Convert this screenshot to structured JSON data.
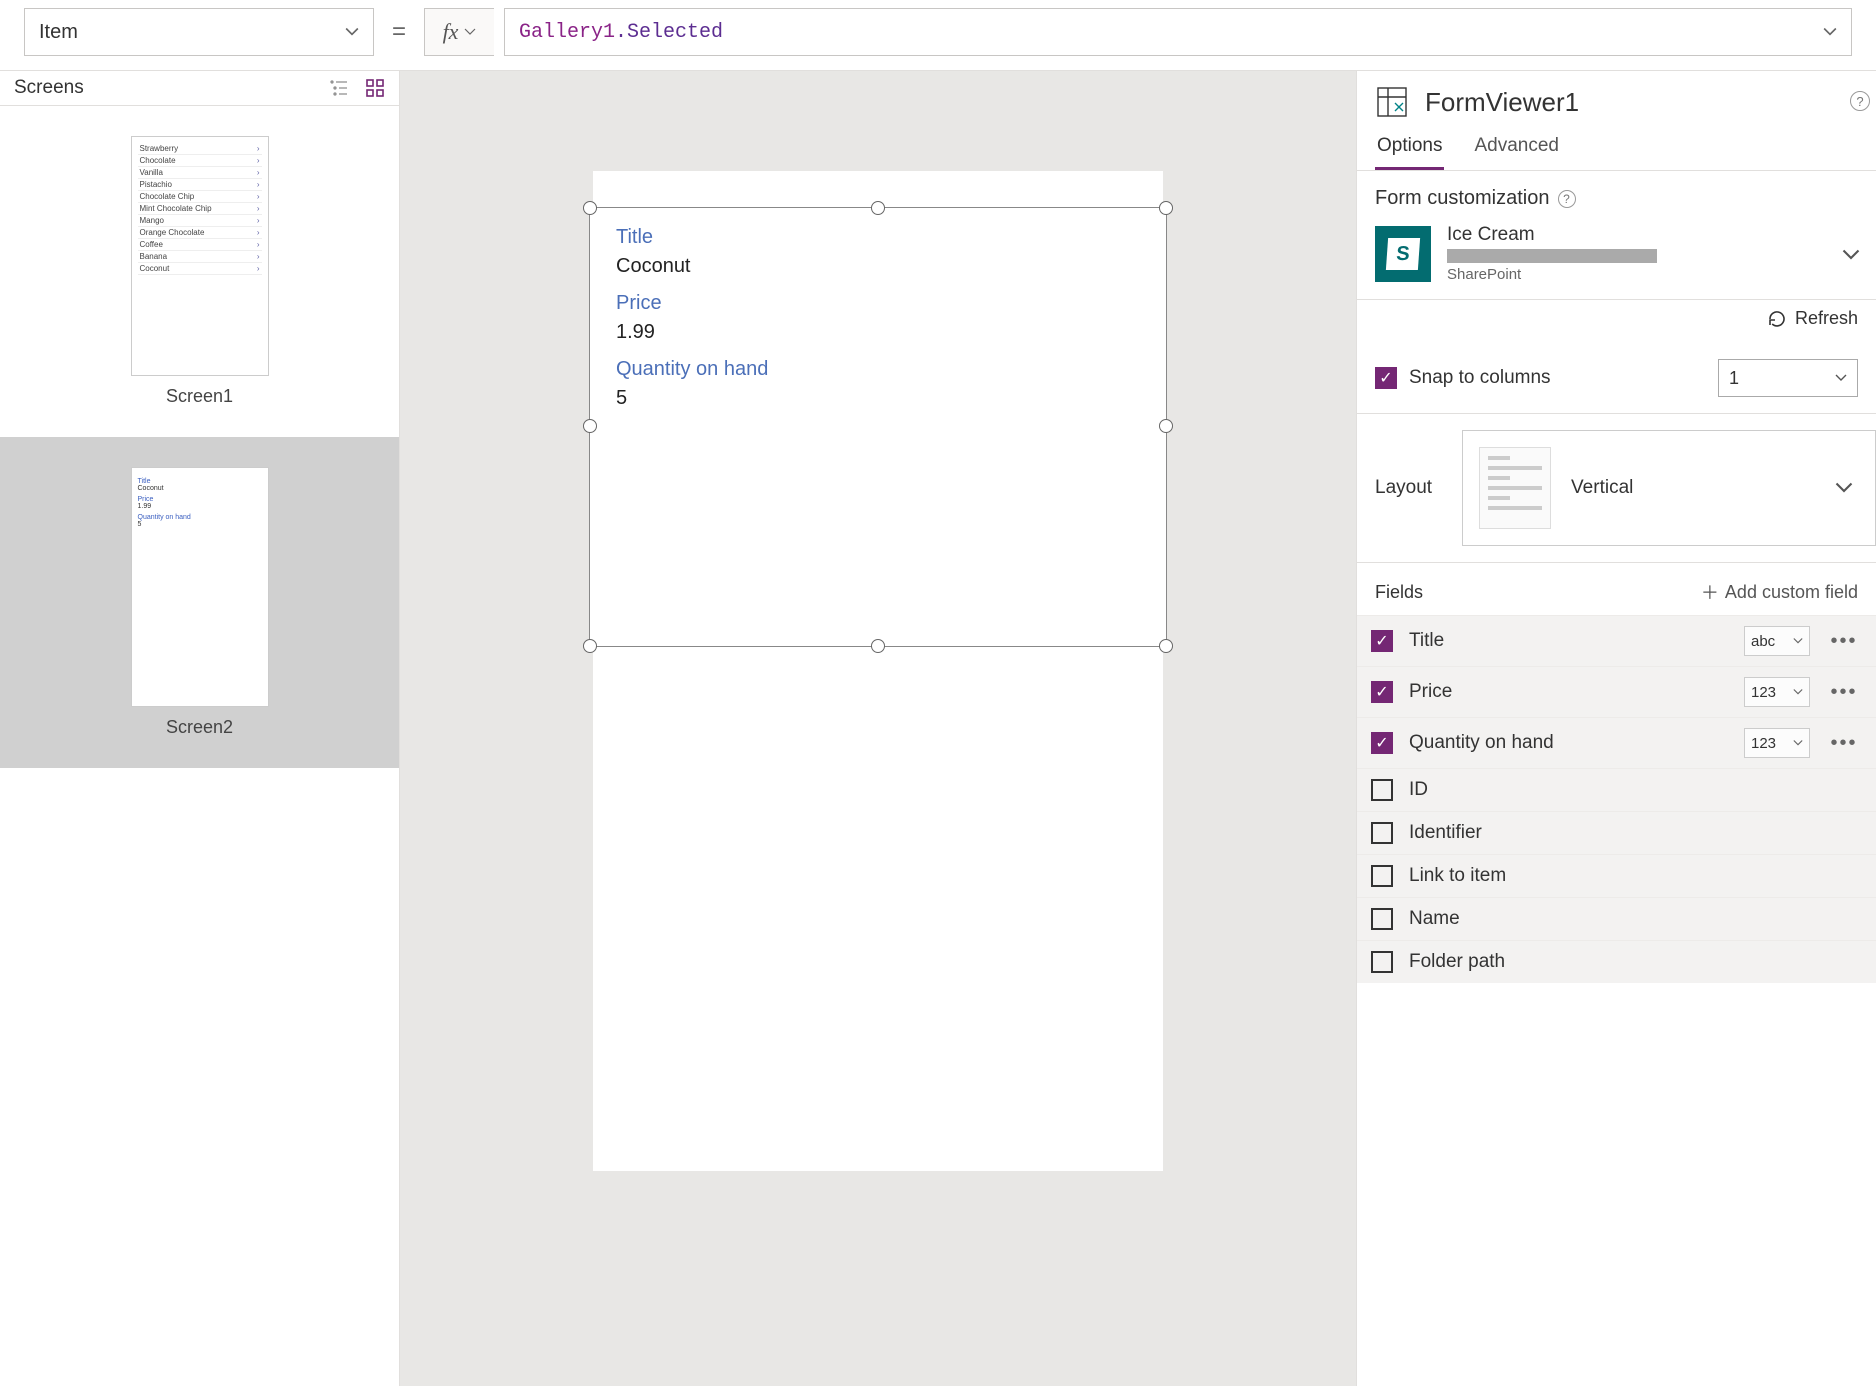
{
  "formula_bar": {
    "property": "Item",
    "equals": "=",
    "fx": "fx",
    "formula_ident": "Gallery1",
    "formula_prop": ".Selected"
  },
  "screens": {
    "header": "Screens",
    "screen1": {
      "caption": "Screen1",
      "rows": [
        "Strawberry",
        "Chocolate",
        "Vanilla",
        "Pistachio",
        "Chocolate Chip",
        "Mint Chocolate Chip",
        "Mango",
        "Orange Chocolate",
        "Coffee",
        "Banana",
        "Coconut"
      ]
    },
    "screen2": {
      "caption": "Screen2",
      "fields": [
        {
          "lbl": "Title",
          "val": "Coconut"
        },
        {
          "lbl": "Price",
          "val": "1.99"
        },
        {
          "lbl": "Quantity on hand",
          "val": "5"
        }
      ]
    }
  },
  "canvas": {
    "form": [
      {
        "lbl": "Title",
        "val": "Coconut"
      },
      {
        "lbl": "Price",
        "val": "1.99"
      },
      {
        "lbl": "Quantity on hand",
        "val": "5"
      }
    ]
  },
  "props": {
    "control_name": "FormViewer1",
    "help_glyph": "?",
    "tabs": {
      "options": "Options",
      "advanced": "Advanced"
    },
    "form_customization": "Form customization",
    "datasource": {
      "name": "Ice Cream",
      "source": "SharePoint"
    },
    "refresh": "Refresh",
    "snap": {
      "label": "Snap to columns",
      "columns": "1"
    },
    "layout": {
      "label": "Layout",
      "value": "Vertical"
    },
    "fields_header": "Fields",
    "add_field": "Add custom field",
    "fields": [
      {
        "label": "Title",
        "type": "abc",
        "checked": true
      },
      {
        "label": "Price",
        "type": "123",
        "checked": true
      },
      {
        "label": "Quantity on hand",
        "type": "123",
        "checked": true
      },
      {
        "label": "ID",
        "type": "",
        "checked": false
      },
      {
        "label": "Identifier",
        "type": "",
        "checked": false
      },
      {
        "label": "Link to item",
        "type": "",
        "checked": false
      },
      {
        "label": "Name",
        "type": "",
        "checked": false
      },
      {
        "label": "Folder path",
        "type": "",
        "checked": false
      }
    ]
  }
}
